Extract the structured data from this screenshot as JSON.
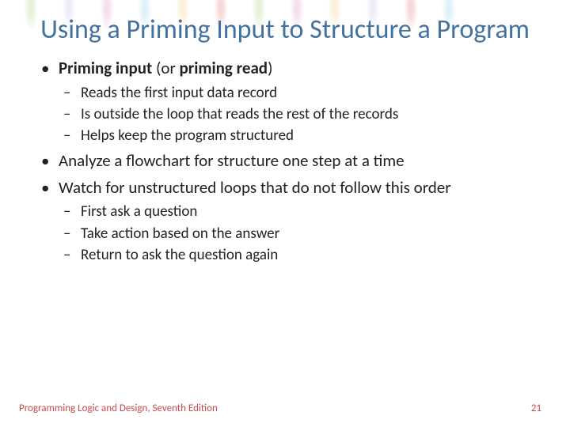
{
  "title": "Using a Priming Input to Structure a Program",
  "bullets": {
    "b1": {
      "term1": "Priming input",
      "mid": " (or ",
      "term2": "priming read",
      "end": ")",
      "sub": [
        "Reads the first input data record",
        "Is outside the loop that reads the rest of the records",
        "Helps keep the program structured"
      ]
    },
    "b2": "Analyze a flowchart for structure one step at a time",
    "b3": {
      "text": "Watch for unstructured loops that do not follow this order",
      "sub": [
        "First ask a question",
        "Take action based on the answer",
        "Return to ask the question again"
      ]
    }
  },
  "footer": {
    "left": "Programming Logic and Design, Seventh Edition",
    "right": "21"
  }
}
